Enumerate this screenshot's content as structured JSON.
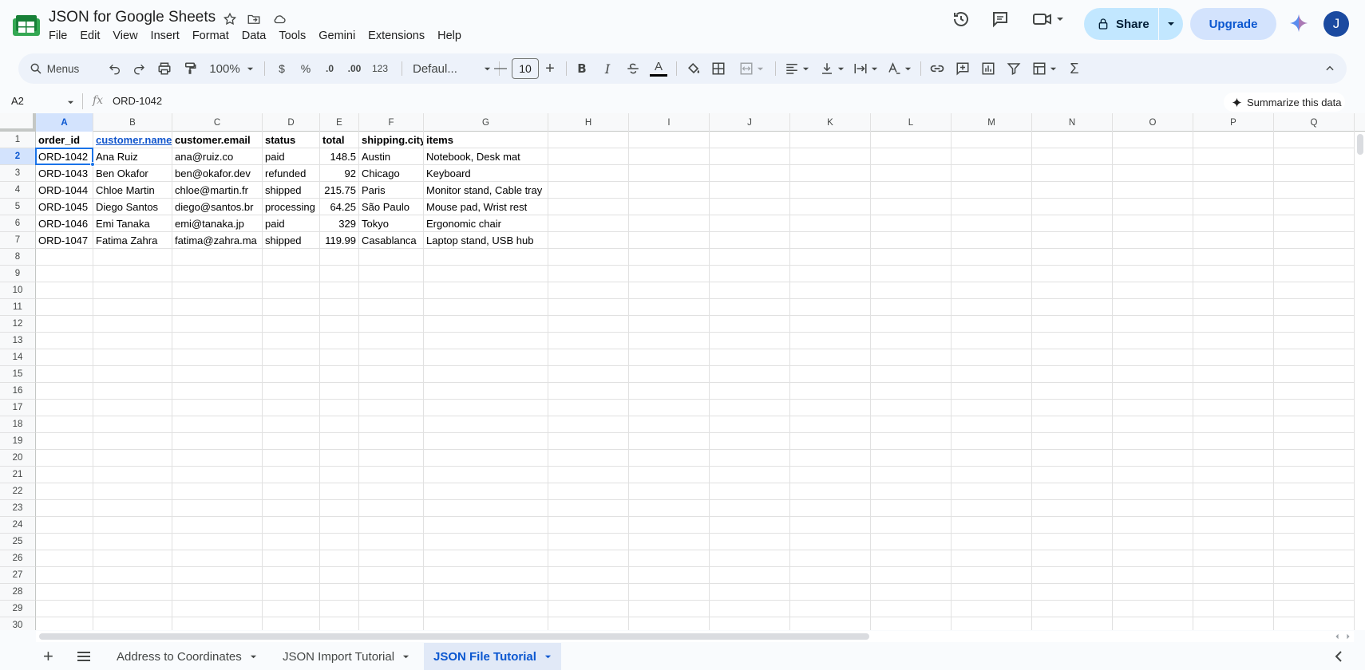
{
  "app": {
    "title": "JSON for Google Sheets",
    "menus": [
      "File",
      "Edit",
      "View",
      "Insert",
      "Format",
      "Data",
      "Tools",
      "Gemini",
      "Extensions",
      "Help"
    ],
    "share_label": "Share",
    "upgrade_label": "Upgrade",
    "avatar_initial": "J"
  },
  "toolbar": {
    "menus_label": "Menus",
    "zoom": "100%",
    "currency": "$",
    "percent": "%",
    "dec_decrease": ".0",
    "dec_increase": ".00",
    "number_format": "123",
    "font_name": "Defaul...",
    "font_size": "10",
    "minus": "—",
    "plus": "+"
  },
  "formula_bar": {
    "cell_ref": "A2",
    "fx": "fx",
    "content": "ORD-1042",
    "summarize_label": "Summarize this data"
  },
  "grid": {
    "columns": [
      "A",
      "B",
      "C",
      "D",
      "E",
      "F",
      "G",
      "H",
      "I",
      "J",
      "K",
      "L",
      "M",
      "N",
      "O",
      "P",
      "Q"
    ],
    "row_numbers": [
      "1",
      "2",
      "3",
      "4",
      "5",
      "6",
      "7",
      "8",
      "9",
      "10",
      "11",
      "12",
      "13",
      "14",
      "15",
      "16",
      "17",
      "18",
      "19",
      "20",
      "21",
      "22",
      "23",
      "24",
      "25",
      "26",
      "27",
      "28",
      "29",
      "30"
    ],
    "header": [
      "order_id",
      "customer.name",
      "customer.email",
      "status",
      "total",
      "shipping.city",
      "items"
    ],
    "rows": [
      [
        "ORD-1042",
        "Ana Ruiz",
        "ana@ruiz.co",
        "paid",
        "148.5",
        "Austin",
        "Notebook, Desk mat"
      ],
      [
        "ORD-1043",
        "Ben Okafor",
        "ben@okafor.dev",
        "refunded",
        "92",
        "Chicago",
        "Keyboard"
      ],
      [
        "ORD-1044",
        "Chloe Martin",
        "chloe@martin.fr",
        "shipped",
        "215.75",
        "Paris",
        "Monitor stand, Cable tray"
      ],
      [
        "ORD-1045",
        "Diego Santos",
        "diego@santos.br",
        "processing",
        "64.25",
        "São Paulo",
        "Mouse pad, Wrist rest"
      ],
      [
        "ORD-1046",
        "Emi Tanaka",
        "emi@tanaka.jp",
        "paid",
        "329",
        "Tokyo",
        "Ergonomic chair"
      ],
      [
        "ORD-1047",
        "Fatima Zahra",
        "fatima@zahra.ma",
        "shipped",
        "119.99",
        "Casablanca",
        "Laptop stand, USB hub"
      ]
    ],
    "selected_cell": "A2"
  },
  "sheets": {
    "tabs": [
      "Address to Coordinates",
      "JSON Import Tutorial",
      "JSON File Tutorial"
    ],
    "active": "JSON File Tutorial"
  },
  "colors": {
    "accent": "#0b57d0",
    "share_bg": "#c2e7ff",
    "upgrade_bg": "#d3e3fd",
    "selection": "#1a73e8",
    "link": "#1155cc"
  }
}
